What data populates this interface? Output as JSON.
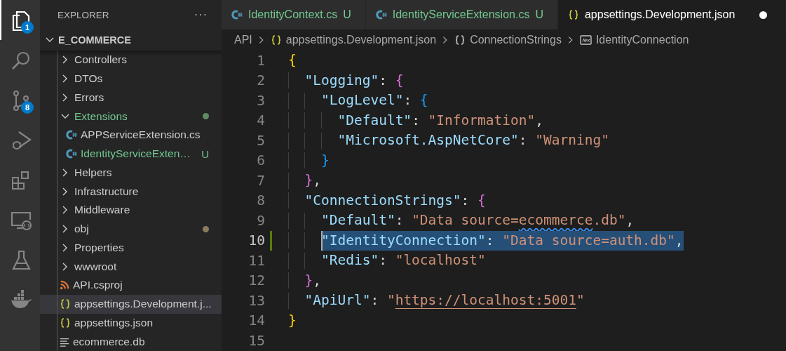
{
  "activity_bar": [
    {
      "kind": "files",
      "selected": true,
      "badge": "1"
    },
    {
      "kind": "search",
      "selected": false
    },
    {
      "kind": "source-control",
      "selected": false,
      "badge": "8"
    },
    {
      "kind": "run-debug",
      "selected": false
    },
    {
      "kind": "extensions",
      "selected": false
    },
    {
      "kind": "remote",
      "selected": false
    },
    {
      "kind": "testing",
      "selected": false
    },
    {
      "kind": "docker",
      "selected": false
    }
  ],
  "explorer": {
    "title": "EXPLORER",
    "more": "···",
    "root": {
      "label": "E_COMMERCE",
      "expanded": true,
      "children": [
        {
          "label": "Controllers",
          "kind": "folder",
          "expanded": false,
          "selected": false
        },
        {
          "label": "DTOs",
          "kind": "folder",
          "expanded": false,
          "selected": false
        },
        {
          "label": "Errors",
          "kind": "folder",
          "expanded": false,
          "selected": false
        },
        {
          "label": "Extensions",
          "kind": "folder",
          "expanded": true,
          "selected": false,
          "untracked": true,
          "color": "#5f8b61",
          "children": [
            {
              "label": "APPServiceExtension.cs",
              "kind": "csharp",
              "selected": false
            },
            {
              "label": "IdentityServiceExten…",
              "kind": "csharp",
              "selected": false,
              "untracked": true,
              "status": "U"
            }
          ]
        },
        {
          "label": "Helpers",
          "kind": "folder",
          "expanded": false,
          "selected": false
        },
        {
          "label": "Infrastructure",
          "kind": "folder",
          "expanded": false,
          "selected": false
        },
        {
          "label": "Middleware",
          "kind": "folder",
          "expanded": false,
          "selected": false
        },
        {
          "label": "obj",
          "kind": "folder",
          "expanded": false,
          "selected": false,
          "color": "#8c7b5f"
        },
        {
          "label": "Properties",
          "kind": "folder",
          "expanded": false,
          "selected": false
        },
        {
          "label": "wwwroot",
          "kind": "folder",
          "expanded": false,
          "selected": false
        },
        {
          "label": "API.csproj",
          "kind": "rss",
          "selected": false
        },
        {
          "label": "appsettings.Development.j...",
          "kind": "json",
          "selected": true
        },
        {
          "label": "appsettings.json",
          "kind": "json",
          "selected": false
        },
        {
          "label": "ecommerce.db",
          "kind": "text",
          "selected": false
        }
      ]
    }
  },
  "tabs": [
    {
      "label": "IdentityContext.cs",
      "kind": "csharp",
      "status": "U",
      "untracked": true,
      "selected": false
    },
    {
      "label": "IdentityServiceExtension.cs",
      "kind": "csharp",
      "status": "U",
      "untracked": true,
      "selected": false
    },
    {
      "label": "appsettings.Development.json",
      "kind": "json",
      "selected": true,
      "dirty": true
    }
  ],
  "breadcrumb": [
    {
      "label": "API",
      "kind": "folder"
    },
    {
      "label": "appsettings.Development.json",
      "kind": "json"
    },
    {
      "label": "ConnectionStrings",
      "kind": "object"
    },
    {
      "label": "IdentityConnection",
      "kind": "string"
    }
  ],
  "editor": {
    "lines": [
      {
        "number": "1",
        "tokens": [
          {
            "text": "{",
            "kind": "brace1"
          }
        ]
      },
      {
        "number": "2",
        "tokens": [
          {
            "text": "  \"Logging\"",
            "kind": "key"
          },
          {
            "text": ": ",
            "kind": "punct"
          },
          {
            "text": "{",
            "kind": "brace2"
          }
        ]
      },
      {
        "number": "3",
        "tokens": [
          {
            "text": "    \"LogLevel\"",
            "kind": "key"
          },
          {
            "text": ": ",
            "kind": "punct"
          },
          {
            "text": "{",
            "kind": "brace3"
          }
        ]
      },
      {
        "number": "4",
        "tokens": [
          {
            "text": "      \"Default\"",
            "kind": "key"
          },
          {
            "text": ": ",
            "kind": "punct"
          },
          {
            "text": "\"Information\"",
            "kind": "string"
          },
          {
            "text": ",",
            "kind": "punct"
          }
        ]
      },
      {
        "number": "5",
        "tokens": [
          {
            "text": "      \"Microsoft.AspNetCore\"",
            "kind": "key"
          },
          {
            "text": ": ",
            "kind": "punct"
          },
          {
            "text": "\"Warning\"",
            "kind": "string"
          }
        ]
      },
      {
        "number": "6",
        "tokens": [
          {
            "text": "    }",
            "kind": "brace3"
          }
        ]
      },
      {
        "number": "7",
        "tokens": [
          {
            "text": "  }",
            "kind": "brace2"
          },
          {
            "text": ",",
            "kind": "punct"
          }
        ]
      },
      {
        "number": "8",
        "tokens": [
          {
            "text": "  \"ConnectionStrings\"",
            "kind": "key"
          },
          {
            "text": ": ",
            "kind": "punct"
          },
          {
            "text": "{",
            "kind": "brace2"
          }
        ]
      },
      {
        "number": "9",
        "tokens": [
          {
            "text": "    \"Default\"",
            "kind": "key"
          },
          {
            "text": ": ",
            "kind": "punct"
          },
          {
            "text": "\"Data source=",
            "kind": "string"
          },
          {
            "text": "ecommerce",
            "kind": "string",
            "squiggle": true
          },
          {
            "text": ".db\"",
            "kind": "string"
          },
          {
            "text": ",",
            "kind": "punct"
          }
        ]
      },
      {
        "number": "10",
        "selected": true,
        "modified": true,
        "tokens": [
          {
            "text": "    \"IdentityConnection\"",
            "kind": "key"
          },
          {
            "text": ": ",
            "kind": "punct"
          },
          {
            "text": "\"Data source=auth.db\"",
            "kind": "string"
          },
          {
            "text": ",",
            "kind": "punct"
          }
        ]
      },
      {
        "number": "11",
        "tokens": [
          {
            "text": "    \"Redis\"",
            "kind": "key"
          },
          {
            "text": ": ",
            "kind": "punct"
          },
          {
            "text": "\"localhost\"",
            "kind": "string"
          }
        ]
      },
      {
        "number": "12",
        "tokens": [
          {
            "text": "  }",
            "kind": "brace2"
          },
          {
            "text": ",",
            "kind": "punct"
          }
        ]
      },
      {
        "number": "13",
        "tokens": [
          {
            "text": "  \"ApiUrl\"",
            "kind": "key"
          },
          {
            "text": ": ",
            "kind": "punct"
          },
          {
            "text": "\"",
            "kind": "string"
          },
          {
            "text": "https://localhost:5001",
            "kind": "link"
          },
          {
            "text": "\"",
            "kind": "string"
          }
        ]
      },
      {
        "number": "14",
        "tokens": [
          {
            "text": "}",
            "kind": "brace1"
          }
        ]
      },
      {
        "number": "15"
      }
    ]
  }
}
